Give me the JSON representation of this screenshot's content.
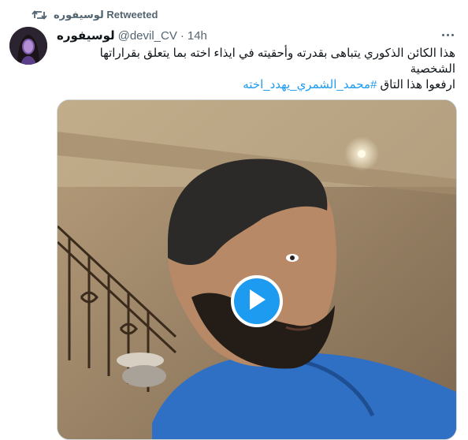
{
  "retweet": {
    "label": "لوسيفوره Retweeted"
  },
  "tweet": {
    "display_name": "لوسيفوره",
    "handle": "@devil_CV",
    "separator": "·",
    "time": "14h",
    "text_line1": "هذا الكائن الذكوري يتباهى بقدرته وأحقيته في ايذاء اخته بما يتعلق بقراراتها الشخصية",
    "text_line2_prefix": "ارفعوا هذا التاق ",
    "hashtag": "#محمد_الشمري_يهدد_اخته"
  },
  "colors": {
    "accent": "#1d9bf0",
    "muted": "#536471",
    "text": "#0f1419"
  },
  "icons": {
    "retweet": "retweet-icon",
    "more": "more-icon",
    "play": "play-icon"
  }
}
